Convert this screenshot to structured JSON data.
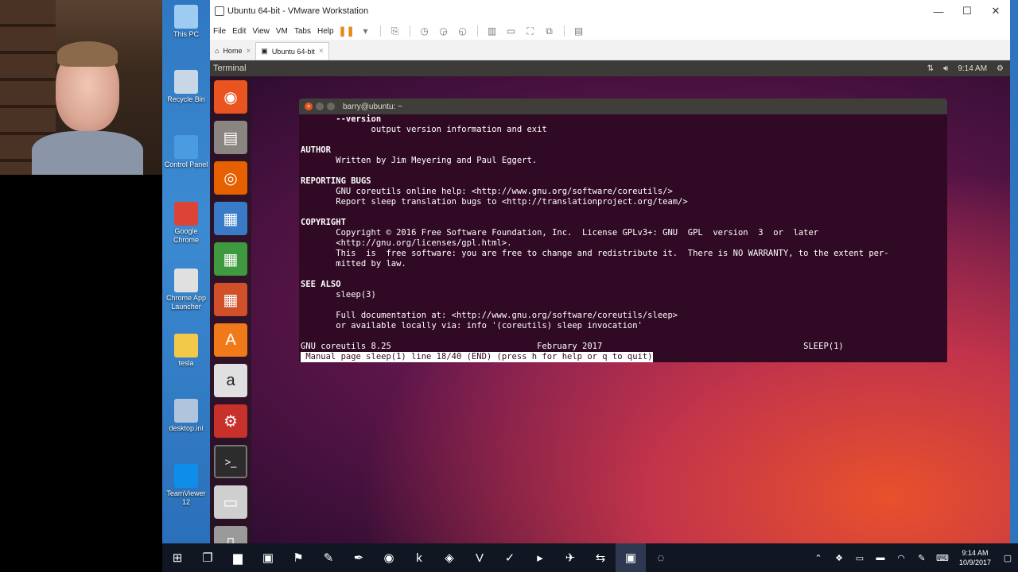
{
  "desktop_icons": [
    {
      "label": "This PC",
      "icon": "this-pc-icon",
      "color": "#9ecbf2"
    },
    {
      "label": "Recycle Bin",
      "icon": "recycle-bin-icon",
      "color": "#c8d7e6"
    },
    {
      "label": "Control Panel",
      "icon": "control-panel-icon",
      "color": "#4a9be0"
    },
    {
      "label": "Google Chrome",
      "icon": "chrome-icon",
      "color": "#db4437"
    },
    {
      "label": "Chrome App Launcher",
      "icon": "app-launcher-icon",
      "color": "#e0e0e0"
    },
    {
      "label": "tesla",
      "icon": "folder-icon",
      "color": "#f3c94a"
    },
    {
      "label": "desktop.ini",
      "icon": "settings-file-icon",
      "color": "#b0c4de"
    },
    {
      "label": "TeamViewer 12",
      "icon": "teamviewer-icon",
      "color": "#0e8ee9"
    }
  ],
  "vmware": {
    "title": "Ubuntu 64-bit - VMware Workstation",
    "menu": [
      "File",
      "Edit",
      "View",
      "VM",
      "Tabs",
      "Help"
    ],
    "tabs": [
      {
        "label": "Home",
        "icon": "home-icon"
      },
      {
        "label": "Ubuntu 64-bit",
        "icon": "vm-icon"
      }
    ]
  },
  "ubuntu": {
    "topbar_title": "Terminal",
    "time": "9:14 AM",
    "launcher": [
      {
        "name": "ubuntu-dash-icon",
        "glyph": "◉",
        "bg": "#e95420"
      },
      {
        "name": "files-icon",
        "glyph": "▤",
        "bg": "#8a8580"
      },
      {
        "name": "firefox-icon",
        "glyph": "◎",
        "bg": "#e66000"
      },
      {
        "name": "writer-icon",
        "glyph": "▦",
        "bg": "#3a7bc8"
      },
      {
        "name": "calc-icon",
        "glyph": "▦",
        "bg": "#3f9a3f"
      },
      {
        "name": "impress-icon",
        "glyph": "▦",
        "bg": "#d0502a"
      },
      {
        "name": "software-center-icon",
        "glyph": "A",
        "bg": "#f07a1a"
      },
      {
        "name": "amazon-icon",
        "glyph": "a",
        "bg": "#e0e0e0"
      },
      {
        "name": "system-settings-icon",
        "glyph": "⚙",
        "bg": "#c8302a"
      },
      {
        "name": "terminal-icon",
        "glyph": ">_",
        "bg": "#2c2c2c"
      },
      {
        "name": "save-icon",
        "glyph": "▭",
        "bg": "#cfcfcf"
      },
      {
        "name": "trash-icon",
        "glyph": "▯",
        "bg": "#9a9a9a"
      }
    ]
  },
  "terminal": {
    "title": "barry@ubuntu: ~",
    "lines": [
      {
        "text": "       --version",
        "bold": true
      },
      {
        "text": "              output version information and exit",
        "bold": false
      },
      {
        "text": "",
        "bold": false
      },
      {
        "text": "AUTHOR",
        "bold": true
      },
      {
        "text": "       Written by Jim Meyering and Paul Eggert.",
        "bold": false
      },
      {
        "text": "",
        "bold": false
      },
      {
        "text": "REPORTING BUGS",
        "bold": true
      },
      {
        "text": "       GNU coreutils online help: <http://www.gnu.org/software/coreutils/>",
        "bold": false
      },
      {
        "text": "       Report sleep translation bugs to <http://translationproject.org/team/>",
        "bold": false
      },
      {
        "text": "",
        "bold": false
      },
      {
        "text": "COPYRIGHT",
        "bold": true
      },
      {
        "text": "       Copyright © 2016 Free Software Foundation, Inc.  License GPLv3+: GNU  GPL  version  3  or  later",
        "bold": false
      },
      {
        "text": "       <http://gnu.org/licenses/gpl.html>.",
        "bold": false
      },
      {
        "text": "       This  is  free software: you are free to change and redistribute it.  There is NO WARRANTY, to the extent per-",
        "bold": false
      },
      {
        "text": "       mitted by law.",
        "bold": false
      },
      {
        "text": "",
        "bold": false
      },
      {
        "text": "SEE ALSO",
        "bold": true
      },
      {
        "text": "       sleep(3)",
        "bold": false
      },
      {
        "text": "",
        "bold": false
      },
      {
        "text": "       Full documentation at: <http://www.gnu.org/software/coreutils/sleep>",
        "bold": false
      },
      {
        "text": "       or available locally via: info '(coreutils) sleep invocation'",
        "bold": false
      },
      {
        "text": "",
        "bold": false
      },
      {
        "text": "GNU coreutils 8.25                             February 2017                                        SLEEP(1)",
        "bold": false
      }
    ],
    "status_line": " Manual page sleep(1) line 18/40 (END) (press h for help or q to quit)"
  },
  "taskbar": {
    "items": [
      {
        "name": "start-icon",
        "glyph": "⊞"
      },
      {
        "name": "task-view-icon",
        "glyph": "❐"
      },
      {
        "name": "file-explorer-icon",
        "glyph": "▆"
      },
      {
        "name": "store-icon",
        "glyph": "▣"
      },
      {
        "name": "app-icon-1",
        "glyph": "⚑"
      },
      {
        "name": "app-icon-2",
        "glyph": "✎"
      },
      {
        "name": "app-icon-3",
        "glyph": "✒"
      },
      {
        "name": "chrome-taskbar-icon",
        "glyph": "◉"
      },
      {
        "name": "app-icon-4",
        "glyph": "k"
      },
      {
        "name": "visual-studio-icon",
        "glyph": "◈"
      },
      {
        "name": "app-icon-5",
        "glyph": "V"
      },
      {
        "name": "notes-icon",
        "glyph": "✓"
      },
      {
        "name": "app-icon-6",
        "glyph": "▸"
      },
      {
        "name": "app-icon-7",
        "glyph": "✈"
      },
      {
        "name": "app-icon-8",
        "glyph": "⇆"
      },
      {
        "name": "vmware-taskbar-icon",
        "glyph": "▣"
      },
      {
        "name": "app-icon-9",
        "glyph": "◌"
      }
    ],
    "clock_time": "9:14 AM",
    "clock_date": "10/9/2017"
  }
}
